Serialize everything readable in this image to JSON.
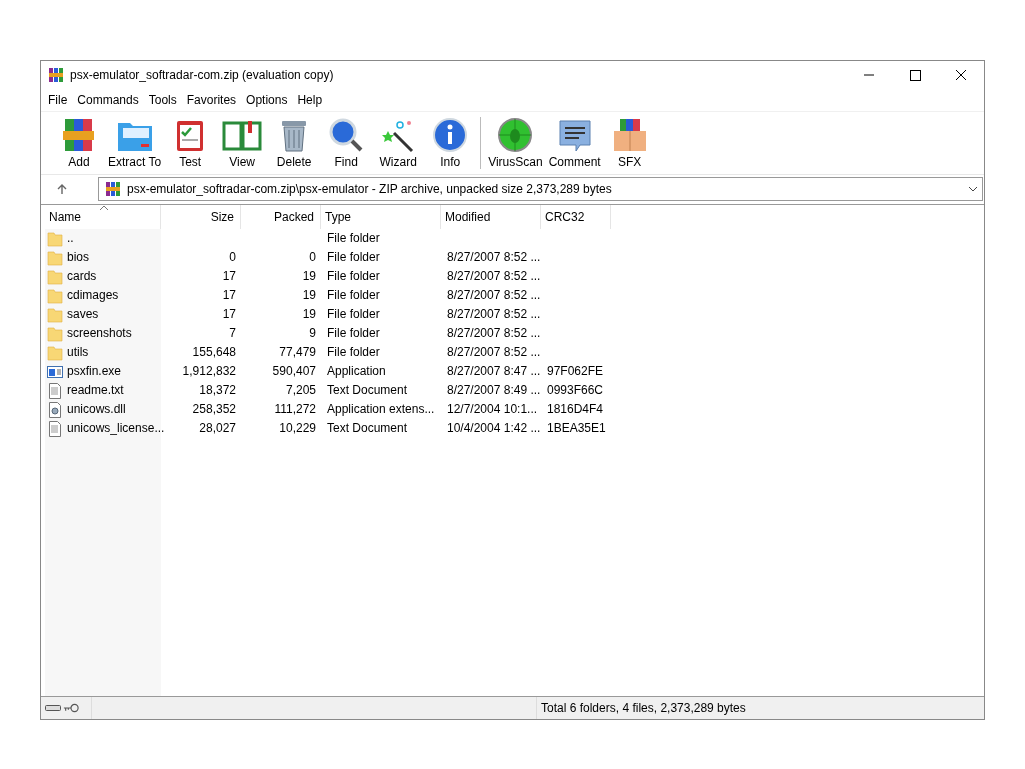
{
  "window": {
    "title": "psx-emulator_softradar-com.zip (evaluation copy)"
  },
  "menu": [
    "File",
    "Commands",
    "Tools",
    "Favorites",
    "Options",
    "Help"
  ],
  "toolbar": [
    {
      "kind": "add",
      "label": "Add"
    },
    {
      "kind": "extract",
      "label": "Extract To"
    },
    {
      "kind": "test",
      "label": "Test"
    },
    {
      "kind": "view",
      "label": "View"
    },
    {
      "kind": "delete",
      "label": "Delete"
    },
    {
      "kind": "find",
      "label": "Find"
    },
    {
      "kind": "wizard",
      "label": "Wizard"
    },
    {
      "kind": "info",
      "label": "Info"
    },
    {
      "kind": "virus",
      "label": "VirusScan"
    },
    {
      "kind": "comment",
      "label": "Comment"
    },
    {
      "kind": "sfx",
      "label": "SFX"
    }
  ],
  "address": "psx-emulator_softradar-com.zip\\psx-emulator - ZIP archive, unpacked size 2,373,289 bytes",
  "table": {
    "columns": [
      "Name",
      "Size",
      "Packed",
      "Type",
      "Modified",
      "CRC32"
    ],
    "rows": [
      {
        "kind": "folder",
        "cells": [
          "..",
          "",
          "",
          "File folder",
          "",
          ""
        ]
      },
      {
        "kind": "folder",
        "cells": [
          "bios",
          "0",
          "0",
          "File folder",
          "8/27/2007 8:52 ...",
          ""
        ]
      },
      {
        "kind": "folder",
        "cells": [
          "cards",
          "17",
          "19",
          "File folder",
          "8/27/2007 8:52 ...",
          ""
        ]
      },
      {
        "kind": "folder",
        "cells": [
          "cdimages",
          "17",
          "19",
          "File folder",
          "8/27/2007 8:52 ...",
          ""
        ]
      },
      {
        "kind": "folder",
        "cells": [
          "saves",
          "17",
          "19",
          "File folder",
          "8/27/2007 8:52 ...",
          ""
        ]
      },
      {
        "kind": "folder",
        "cells": [
          "screenshots",
          "7",
          "9",
          "File folder",
          "8/27/2007 8:52 ...",
          ""
        ]
      },
      {
        "kind": "folder",
        "cells": [
          "utils",
          "155,648",
          "77,479",
          "File folder",
          "8/27/2007 8:52 ...",
          ""
        ]
      },
      {
        "kind": "exe",
        "cells": [
          "psxfin.exe",
          "1,912,832",
          "590,407",
          "Application",
          "8/27/2007 8:47 ...",
          "97F062FE"
        ]
      },
      {
        "kind": "text",
        "cells": [
          "readme.txt",
          "18,372",
          "7,205",
          "Text Document",
          "8/27/2007 8:49 ...",
          "0993F66C"
        ]
      },
      {
        "kind": "dll",
        "cells": [
          "unicows.dll",
          "258,352",
          "111,272",
          "Application extens...",
          "12/7/2004 10:1...",
          "1816D4F4"
        ]
      },
      {
        "kind": "text",
        "cells": [
          "unicows_license...",
          "28,027",
          "10,229",
          "Text Document",
          "10/4/2004 1:42 ...",
          "1BEA35E1"
        ]
      }
    ]
  },
  "status_bar": "Total 6 folders, 4 files, 2,373,289 bytes"
}
